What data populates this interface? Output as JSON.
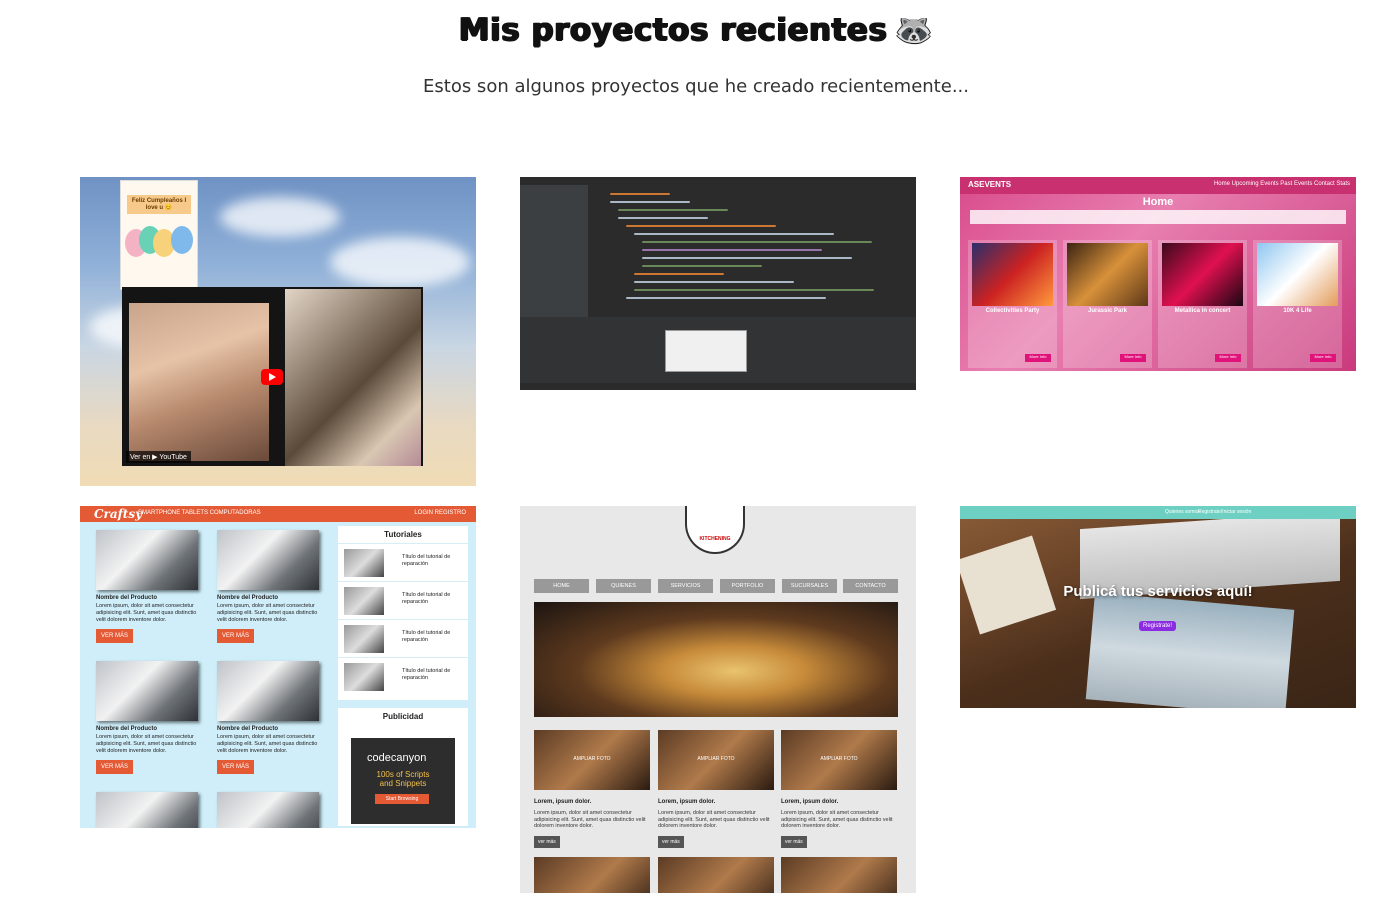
{
  "header": {
    "title": "Mis proyectos recientes",
    "title_emoji": "🦝",
    "subtitle": "Estos son algunos proyectos que he creado recientemente..."
  },
  "projects": [
    {
      "banner": "Feliz Cumpleaños\nI love u 😊",
      "video_label": "Ver en ▶ YouTube"
    },
    {
      "ide": true
    },
    {
      "logo": "ASEVENTS",
      "nav": "Home  Upcoming Events  Past Events  Contact  Stats",
      "heading": "Home",
      "events": [
        {
          "title": "Collectivities Party",
          "button": "More Info"
        },
        {
          "title": "Jurassic Park",
          "button": "More Info"
        },
        {
          "title": "Metallica in concert",
          "button": "More Info"
        },
        {
          "title": "10K 4 Life",
          "button": "More Info"
        }
      ]
    },
    {
      "brand": "Craftsy",
      "nav": "SMARTPHONE  TABLETS  COMPUTADORAS",
      "auth": "LOGIN  REGISTRO",
      "products": [
        {
          "name": "Nombre del Producto",
          "desc": "Lorem ipsum, dolor sit amet consectetur adipisicing elit. Sunt, amet quas distinctio velit dolorem inventore dolor.",
          "button": "VER MÁS"
        },
        {
          "name": "Nombre del Producto",
          "desc": "Lorem ipsum, dolor sit amet consectetur adipisicing elit. Sunt, amet quas distinctio velit dolorem inventore dolor.",
          "button": "VER MÁS"
        },
        {
          "name": "Nombre del Producto",
          "desc": "Lorem ipsum, dolor sit amet consectetur adipisicing elit. Sunt, amet quas distinctio velit dolorem inventore dolor.",
          "button": "VER MÁS"
        },
        {
          "name": "Nombre del Producto",
          "desc": "Lorem ipsum, dolor sit amet consectetur adipisicing elit. Sunt, amet quas distinctio velit dolorem inventore dolor.",
          "button": "VER MÁS"
        }
      ],
      "tutorials_title": "Tutoriales",
      "tutorials": [
        "Título del tutorial de reparación",
        "Título del tutorial de reparación",
        "Título del tutorial de reparación",
        "Título del tutorial de reparación"
      ],
      "ad_title": "Publicidad",
      "ad_brand": "codecanyon",
      "ad_text": "100s of Scripts and Snippets",
      "ad_button": "Start Browsing"
    },
    {
      "logo": "KITCHENING",
      "nav": [
        "HOME",
        "QUIENES",
        "SERVICIOS",
        "PORTFOLIO",
        "SUCURSALES",
        "CONTACTO"
      ],
      "items": [
        {
          "overlay": "AMPLIAR FOTO",
          "title": "Lorem, ipsum dolor.",
          "desc": "Lorem ipsum, dolor sit amet consectetur adipisicing elit. Sunt, amet quas distinctio velit dolorem inventore dolor.",
          "button": "ver más"
        },
        {
          "overlay": "AMPLIAR FOTO",
          "title": "Lorem, ipsum dolor.",
          "desc": "Lorem ipsum, dolor sit amet consectetur adipisicing elit. Sunt, amet quas distinctio velit dolorem inventore dolor.",
          "button": "ver más"
        },
        {
          "overlay": "AMPLIAR FOTO",
          "title": "Lorem, ipsum dolor.",
          "desc": "Lorem ipsum, dolor sit amet consectetur adipisicing elit. Sunt, amet quas distinctio velit dolorem inventore dolor.",
          "button": "ver más"
        }
      ]
    },
    {
      "topbar": [
        "Quienes somos",
        "Registrate/Iniciar sesión"
      ],
      "headline": "Publicá tus servicios aquí!",
      "button": "Registrate!"
    }
  ]
}
